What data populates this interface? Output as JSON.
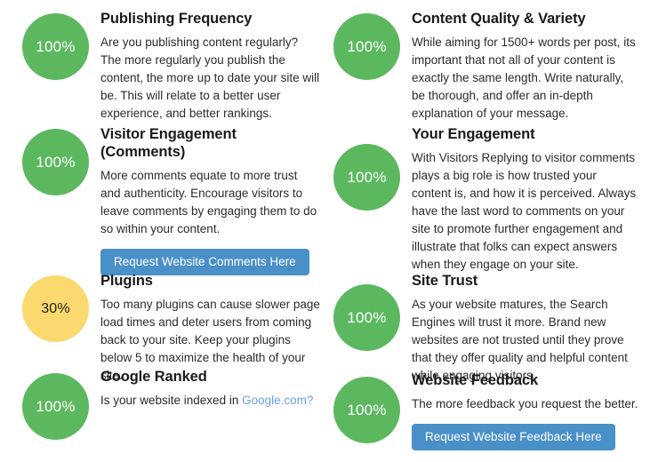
{
  "theme": {
    "green": "#5cb85f",
    "yellow": "#fad96e",
    "button_blue": "#4a90c8",
    "link_blue": "#6d9eeb",
    "background": "#ffffff",
    "text": "#2b2b2b"
  },
  "columns": {
    "left": {
      "items": [
        {
          "score": "100%",
          "score_state": "green",
          "title": "Publishing Frequency",
          "description": "Are you publishing content regularly? The more regularly you publish the content, the more up to date your site will be. This will relate to a better user experience, and better rankings."
        },
        {
          "score": "100%",
          "score_state": "green",
          "title": "Visitor Engagement (Comments)",
          "description": "More comments equate to more trust and authenticity. Encourage visitors to leave comments by engaging them to do so within your content.",
          "button_label": "Request Website Comments Here"
        },
        {
          "score": "30%",
          "score_state": "yellow",
          "title": "Plugins",
          "description": "Too many plugins can cause slower page load times and deter users from coming back to your site. Keep your plugins below 5 to maximize the health of your site."
        },
        {
          "score": "100%",
          "score_state": "green",
          "title": "Google Ranked",
          "description_prefix": "Is your website indexed in ",
          "link_text": "Google.com?"
        }
      ]
    },
    "right": {
      "items": [
        {
          "score": "100%",
          "score_state": "green",
          "title": "Content Quality & Variety",
          "description": "While aiming for 1500+ words per post, its important that not all of your content is exactly the same length. Write naturally, be thorough, and offer an in-depth explanation of your message."
        },
        {
          "score": "100%",
          "score_state": "green",
          "title": "Your Engagement",
          "description": "With Visitors Replying to visitor comments plays a big role is how trusted your content is, and how it is perceived. Always have the last word to comments on your site to promote further engagement and illustrate that folks can expect answers when they engage on your site."
        },
        {
          "score": "100%",
          "score_state": "green",
          "title": "Site Trust",
          "description": "As your website matures, the Search Engines will trust it more. Brand new websites are not trusted until they prove that they offer quality and helpful content while engaging visitors."
        },
        {
          "score": "100%",
          "score_state": "green",
          "title": "Website Feedback",
          "description": "The more feedback you request the better.",
          "button_label": "Request Website Feedback Here"
        }
      ]
    }
  }
}
